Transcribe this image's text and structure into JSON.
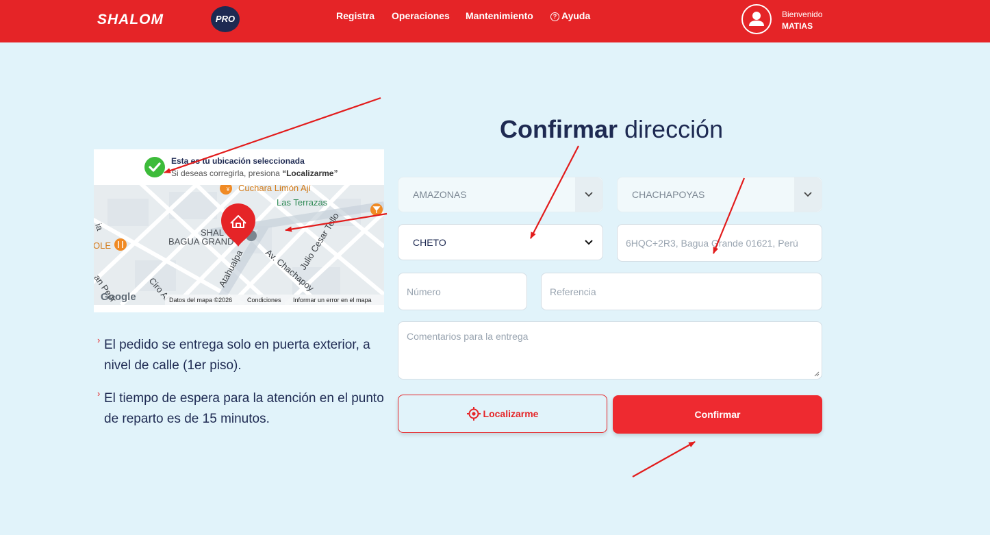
{
  "header": {
    "logo_text": "SHALOM",
    "logo_badge": "PRO",
    "nav": [
      "Registra",
      "Operaciones",
      "Mantenimiento",
      "Ayuda"
    ],
    "welcome": "Bienvenido",
    "user_name": "MATIAS"
  },
  "map": {
    "banner_title": "Esta es tu ubicación seleccionada",
    "banner_sub_prefix": "Si deseas corregirla, presiona ",
    "banner_sub_action": "“Localizarme”",
    "places": [
      "Cuchara Limón Ají",
      "Las Terrazas",
      "SHAL",
      "BAGUA GRAND",
      "OLE"
    ],
    "streets": [
      "Atahualpa",
      "Av. Chachapoy",
      "Julio Cesar Tello",
      "Ciro Al",
      "an Pedr",
      "ia"
    ],
    "attribution": [
      "Datos del mapa ©2026",
      "Condiciones",
      "Informar un error en el mapa"
    ],
    "provider": "Google"
  },
  "info": [
    "El pedido se entrega solo en puerta exterior, a nivel de calle (1er piso).",
    "El tiempo de espera para la atención en el punto de reparto es de 15 minutos."
  ],
  "form": {
    "title_bold": "Confirmar",
    "title_rest": " dirección",
    "department": "AMAZONAS",
    "province": "CHACHAPOYAS",
    "district": "CHETO",
    "address_placeholder": "6HQC+2R3, Bagua Grande 01621, Perú",
    "number_placeholder": "Número",
    "reference_placeholder": "Referencia",
    "comments_placeholder": "Comentarios para la entrega",
    "locate_label": "Localizarme",
    "confirm_label": "Confirmar"
  },
  "colors": {
    "brand_red": "#e52427",
    "navy": "#1e2a52",
    "background": "#e1f3fa",
    "annotation_arrow": "#e21b1b"
  },
  "icons": [
    "user-icon",
    "help-icon",
    "check-icon",
    "home-pin-icon",
    "chevron-down-icon",
    "target-icon",
    "restaurant-icon",
    "bar-icon"
  ]
}
